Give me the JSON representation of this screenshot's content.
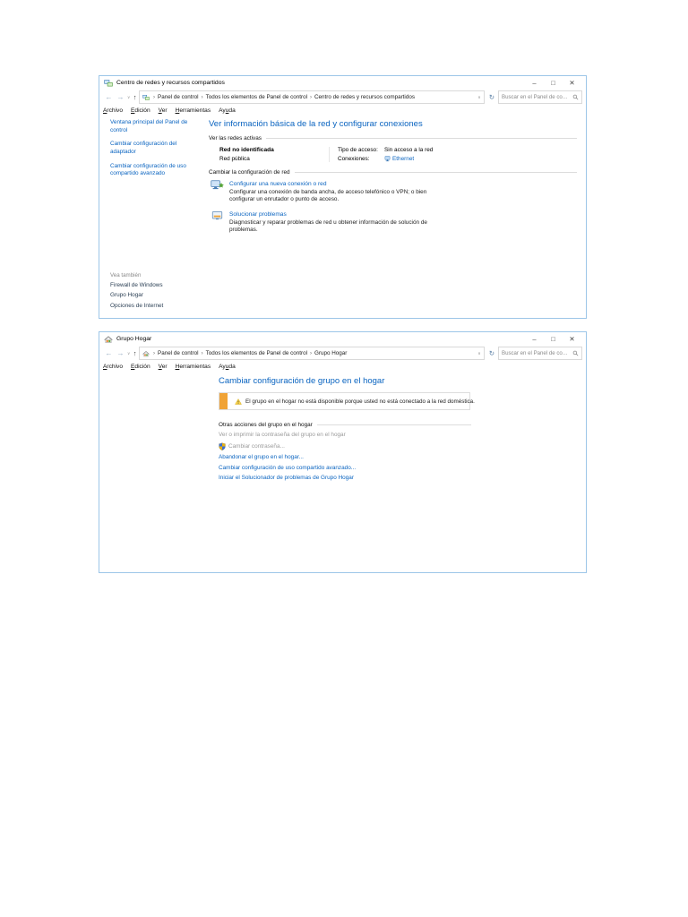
{
  "colors": {
    "window_border": "#9dc6e8",
    "link_blue": "#0a64c0",
    "heading_blue": "#0a64c0",
    "see_also_dark": "#2c4055",
    "rule_gray": "#dcdcdc",
    "warning_accent": "#f0a336",
    "disabled_gray": "#9b9b9b"
  },
  "chrome": {
    "back": "←",
    "forward": "→",
    "dropdown": "∨",
    "up": "↑",
    "address_dropdown": "∨",
    "refresh": "↻",
    "crumb_sep": "›",
    "minimize": "–",
    "maximize": "□",
    "close": "✕"
  },
  "window1": {
    "title": "Centro de redes y recursos compartidos",
    "breadcrumb": [
      "Panel de control",
      "Todos los elementos de Panel de control",
      "Centro de redes y recursos compartidos"
    ],
    "search_placeholder": "Buscar en el Panel de co…",
    "menu": [
      {
        "label": "Archivo",
        "accel": 0
      },
      {
        "label": "Edición",
        "accel": 0
      },
      {
        "label": "Ver",
        "accel": 0
      },
      {
        "label": "Herramientas",
        "accel": 0
      },
      {
        "label": "Ayuda",
        "accel": 2
      }
    ],
    "sidebar": {
      "items": [
        "Ventana principal del Panel de control",
        "Cambiar configuración del adaptador",
        "Cambiar configuración de uso compartido avanzado"
      ],
      "see_also_label": "Vea también",
      "see_also_items": [
        "Firewall de Windows",
        "Grupo Hogar",
        "Opciones de Internet"
      ]
    },
    "main": {
      "heading": "Ver información básica de la red y configurar conexiones",
      "active_networks_label": "Ver las redes activas",
      "network": {
        "name": "Red no identificada",
        "profile": "Red pública",
        "access_label": "Tipo de acceso:",
        "access_value": "Sin acceso a la red",
        "connections_label": "Conexiones:",
        "connection_link": "Ethernet"
      },
      "change_network_label": "Cambiar la configuración de red",
      "tasks": [
        {
          "title": "Configurar una nueva conexión o red",
          "desc": "Configurar una conexión de banda ancha, de acceso telefónico o VPN; o bien configurar un enrutador o punto de acceso."
        },
        {
          "title": "Solucionar problemas",
          "desc": "Diagnosticar y reparar problemas de red u obtener información de solución de problemas."
        }
      ]
    }
  },
  "window2": {
    "title": "Grupo Hogar",
    "breadcrumb": [
      "Panel de control",
      "Todos los elementos de Panel de control",
      "Grupo Hogar"
    ],
    "search_placeholder": "Buscar en el Panel de co…",
    "menu": [
      {
        "label": "Archivo",
        "accel": 0
      },
      {
        "label": "Edición",
        "accel": 0
      },
      {
        "label": "Ver",
        "accel": 0
      },
      {
        "label": "Herramientas",
        "accel": 0
      },
      {
        "label": "Ayuda",
        "accel": 2
      }
    ],
    "main": {
      "heading": "Cambiar configuración de grupo en el hogar",
      "warning": "El grupo en el hogar no está disponible porque usted no está conectado a la red doméstica.",
      "other_actions_label": "Otras acciones del grupo en el hogar",
      "password_item": "Ver o imprimir la contraseña del grupo en el hogar",
      "change_password_item": "Cambiar contraseña...",
      "links": [
        "Abandonar el grupo en el hogar...",
        "Cambiar configuración de uso compartido avanzado...",
        "Iniciar el Solucionador de problemas de Grupo Hogar"
      ]
    }
  }
}
